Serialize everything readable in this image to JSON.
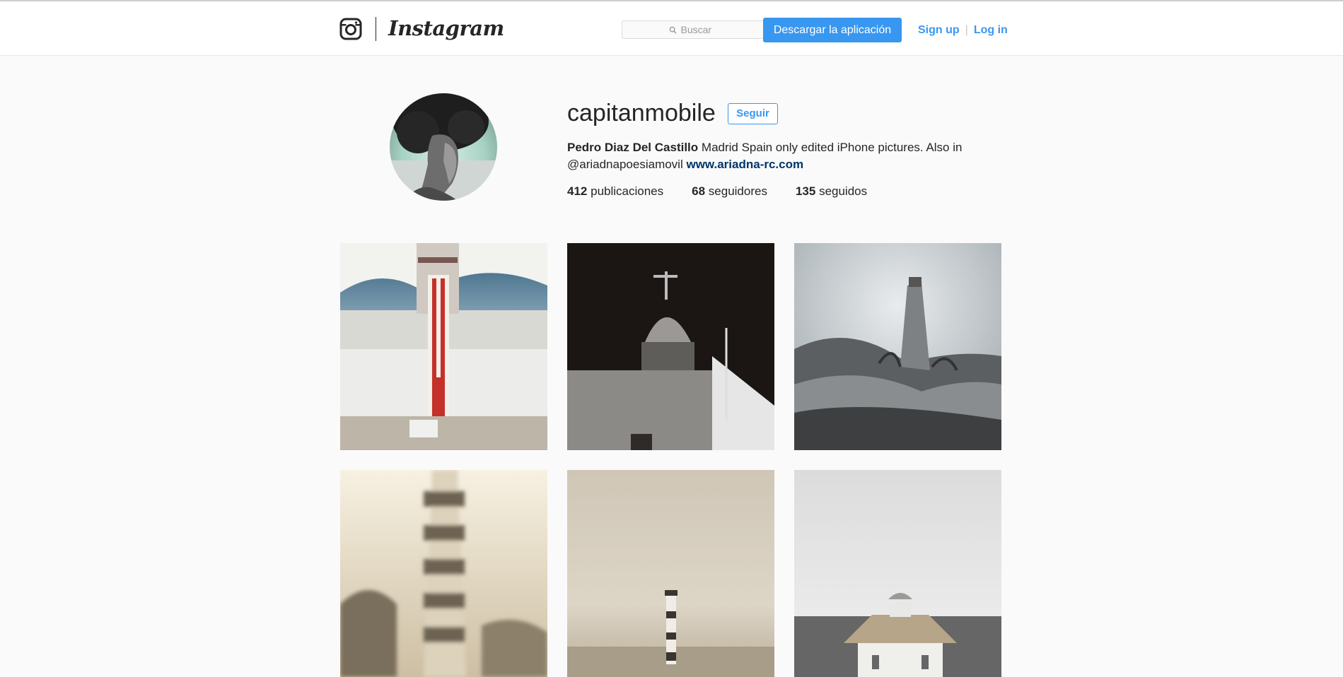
{
  "header": {
    "brand": "Instagram",
    "search": {
      "placeholder": "Buscar"
    },
    "download_label": "Descargar la aplicación",
    "signup_label": "Sign up",
    "login_label": "Log in"
  },
  "profile": {
    "username": "capitanmobile",
    "follow_label": "Seguir",
    "full_name": "Pedro Diaz Del Castillo",
    "bio_text": "Madrid Spain only edited iPhone pictures. Also in @ariadnapoesiamovil",
    "website": "www.ariadna-rc.com",
    "stats": [
      {
        "count": "412",
        "label": "publicaciones"
      },
      {
        "count": "68",
        "label": "seguidores"
      },
      {
        "count": "135",
        "label": "seguidos"
      }
    ]
  },
  "colors": {
    "accent": "#3897f0",
    "link_dark": "#003569",
    "background": "#fafafa"
  }
}
